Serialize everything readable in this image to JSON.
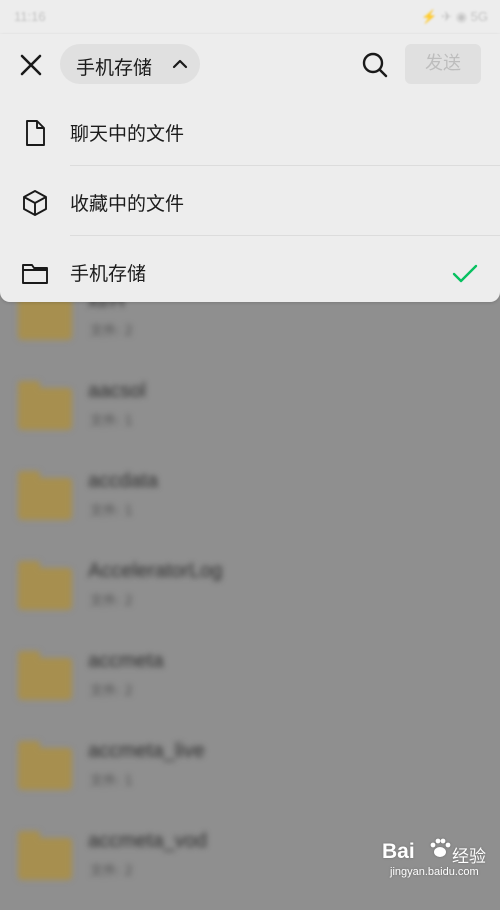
{
  "status_bar": {
    "time": "11:16",
    "right_text": "⚡ ✈ ◉ 5G"
  },
  "header": {
    "location_label": "手机存储",
    "send_label": "发送"
  },
  "menu": {
    "items": [
      {
        "label": "聊天中的文件",
        "icon": "document-icon"
      },
      {
        "label": "收藏中的文件",
        "icon": "cube-icon"
      },
      {
        "label": "手机存储",
        "icon": "folder-icon",
        "selected": true
      }
    ]
  },
  "file_list": {
    "items": [
      {
        "name": "xtrH",
        "meta": "文件: 2"
      },
      {
        "name": "aacsol",
        "meta": "文件: 1"
      },
      {
        "name": "accdata",
        "meta": "文件: 1"
      },
      {
        "name": "AcceleratorLog",
        "meta": "文件: 2"
      },
      {
        "name": "accmeta",
        "meta": "文件: 2"
      },
      {
        "name": "accmeta_live",
        "meta": "文件: 1"
      },
      {
        "name": "accmeta_vod",
        "meta": "文件: 2"
      }
    ]
  },
  "watermark": {
    "brand": "Bai",
    "brand_cn": "经验",
    "url": "jingyan.baidu.com"
  },
  "colors": {
    "check_green": "#07c160",
    "panel_bg": "#ededed",
    "folder": "#a78f4f"
  }
}
